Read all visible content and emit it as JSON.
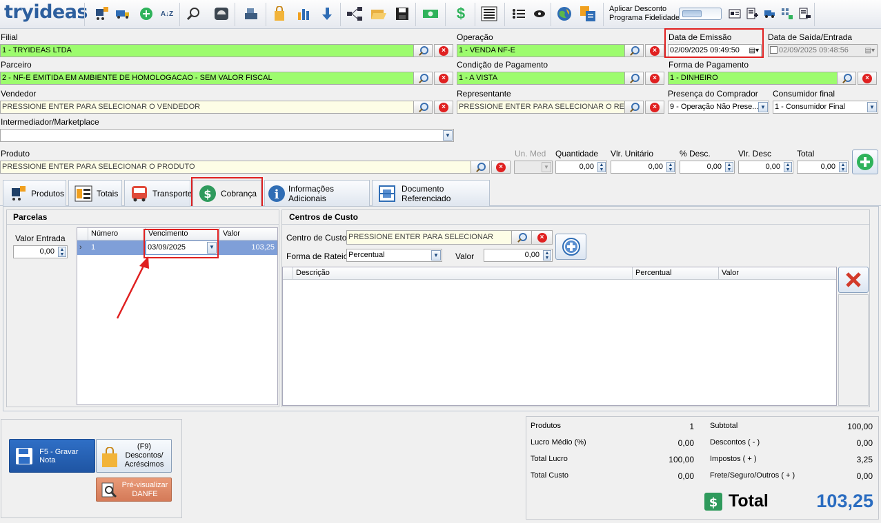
{
  "app": {
    "logo": "tryideas"
  },
  "toolbar": {
    "icons": [
      "cart-add-icon",
      "truck-icon",
      "plus-circle-icon",
      "sort-az-icon",
      "search-doc-icon",
      "scale-icon",
      "cash-register-icon",
      "bag-icon",
      "bar-chart-icon",
      "arrow-down-icon",
      "hierarchy-icon",
      "folder-open-icon",
      "save-icon",
      "money-icon",
      "dollar-icon",
      "barcode-icon",
      "list-icon",
      "eye-icon",
      "globe-icon",
      "transfer-icon"
    ],
    "discount_line1": "Aplicar Desconto",
    "discount_line2": "Programa Fidelidade",
    "right_icons": [
      "id-card-icon",
      "doc-add-icon",
      "truck-small-icon",
      "grid-icon",
      "doc-edit-icon"
    ]
  },
  "form": {
    "filial": {
      "label": "Filial",
      "value": "1 - TRYIDEAS LTDA"
    },
    "operacao": {
      "label": "Operação",
      "value": "1 - VENDA NF-E"
    },
    "data_emissao": {
      "label": "Data de Emissão",
      "value": "02/09/2025 09:49:50"
    },
    "data_saida": {
      "label": "Data de Saída/Entrada",
      "value": "02/09/2025 09:48:56"
    },
    "parceiro": {
      "label": "Parceiro",
      "value": "2 - NF-E EMITIDA EM AMBIENTE DE HOMOLOGACAO - SEM VALOR FISCAL"
    },
    "condicao": {
      "label": "Condição de Pagamento",
      "value": "1 - A VISTA"
    },
    "forma": {
      "label": "Forma de Pagamento",
      "value": "1 - DINHEIRO"
    },
    "vendedor": {
      "label": "Vendedor",
      "value": "PRESSIONE ENTER PARA SELECIONAR O VENDEDOR"
    },
    "representante": {
      "label": "Representante",
      "value": "PRESSIONE ENTER PARA SELECIONAR O REPRES"
    },
    "presenca": {
      "label": "Presença do Comprador",
      "value": "9 - Operação Não Prese..."
    },
    "consumidor": {
      "label": "Consumidor final",
      "value": "1 - Consumidor Final"
    },
    "intermediador": {
      "label": "Intermediador/Marketplace",
      "value": ""
    }
  },
  "produto": {
    "label": "Produto",
    "value": "PRESSIONE ENTER PARA SELECIONAR O PRODUTO",
    "un_label": "Un. Med",
    "qtd_label": "Quantidade",
    "qtd": "0,00",
    "unit_label": "Vlr. Unitário",
    "unit": "0,00",
    "pdesc_label": "% Desc.",
    "pdesc": "0,00",
    "vdesc_label": "Vlr. Desc",
    "vdesc": "0,00",
    "total_label": "Total",
    "total": "0,00"
  },
  "tabs": [
    "Produtos",
    "Totais",
    "Transporte",
    "Cobrança",
    "Informações Adicionais",
    "Documento Referenciado"
  ],
  "parcelas": {
    "title": "Parcelas",
    "valor_entrada_label": "Valor Entrada",
    "valor_entrada": "0,00",
    "columns": [
      "Número",
      "Vencimento",
      "Valor"
    ],
    "rows": [
      {
        "numero": "1",
        "vencimento": "03/09/2025",
        "valor": "103,25"
      }
    ]
  },
  "centros": {
    "title": "Centros de Custo",
    "centro_label": "Centro de Custo",
    "centro_value": "PRESSIONE ENTER PARA SELECIONAR",
    "rateio_label": "Forma de Rateio",
    "rateio_value": "Percentual",
    "valor_label": "Valor",
    "valor": "0,00",
    "columns": [
      "Descrição",
      "Percentual",
      "Valor"
    ]
  },
  "actions": {
    "gravar": "F5 - Gravar Nota",
    "descontos_1": "(F9)",
    "descontos_2": "Descontos/",
    "descontos_3": "Acréscimos",
    "preview_1": "Pré-visualizar",
    "preview_2": "DANFE"
  },
  "totals": {
    "produtos_label": "Produtos",
    "produtos": "1",
    "lucro_medio_label": "Lucro Médio (%)",
    "lucro_medio": "0,00",
    "total_lucro_label": "Total Lucro",
    "total_lucro": "100,00",
    "total_custo_label": "Total Custo",
    "total_custo": "0,00",
    "subtotal_label": "Subtotal",
    "subtotal": "100,00",
    "descontos_label": "Descontos ( - )",
    "descontos": "0,00",
    "impostos_label": "Impostos ( + )",
    "impostos": "3,25",
    "frete_label": "Frete/Seguro/Outros ( + )",
    "frete": "0,00",
    "total_label": "Total",
    "total": "103,25"
  },
  "colors": {
    "green_field": "#9dfc6e",
    "highlight": "#e02020",
    "total_blue": "#2a6cc0"
  }
}
